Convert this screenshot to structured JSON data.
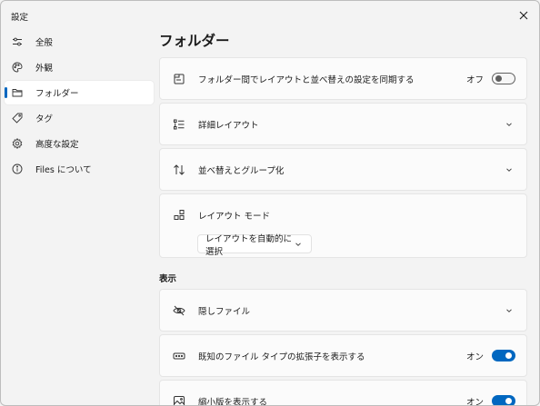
{
  "window": {
    "title": "設定"
  },
  "sidebar": {
    "items": [
      {
        "label": "全般",
        "icon": "sliders-icon"
      },
      {
        "label": "外観",
        "icon": "palette-icon"
      },
      {
        "label": "フォルダー",
        "icon": "folder-icon",
        "active": true
      },
      {
        "label": "タグ",
        "icon": "tag-icon"
      },
      {
        "label": "高度な設定",
        "icon": "gear-icon"
      },
      {
        "label": "Files について",
        "icon": "info-icon"
      }
    ]
  },
  "main": {
    "title": "フォルダー",
    "sync_layout": {
      "label": "フォルダー間でレイアウトと並べ替えの設定を同期する",
      "state": "オフ",
      "on": false
    },
    "detail_layout": {
      "label": "詳細レイアウト"
    },
    "sort_group": {
      "label": "並べ替えとグループ化"
    },
    "layout_mode": {
      "label": "レイアウト モード",
      "dropdown_value": "レイアウトを自動的に選択"
    },
    "section_display": "表示",
    "hidden_files": {
      "label": "隠しファイル"
    },
    "show_extensions": {
      "label": "既知のファイル タイプの拡張子を表示する",
      "state": "オン",
      "on": true
    },
    "show_thumbnails": {
      "label": "縮小版を表示する",
      "state": "オン",
      "on": true
    }
  },
  "colors": {
    "accent": "#0067c0",
    "background": "#f3f3f3",
    "card": "#fbfbfb"
  }
}
